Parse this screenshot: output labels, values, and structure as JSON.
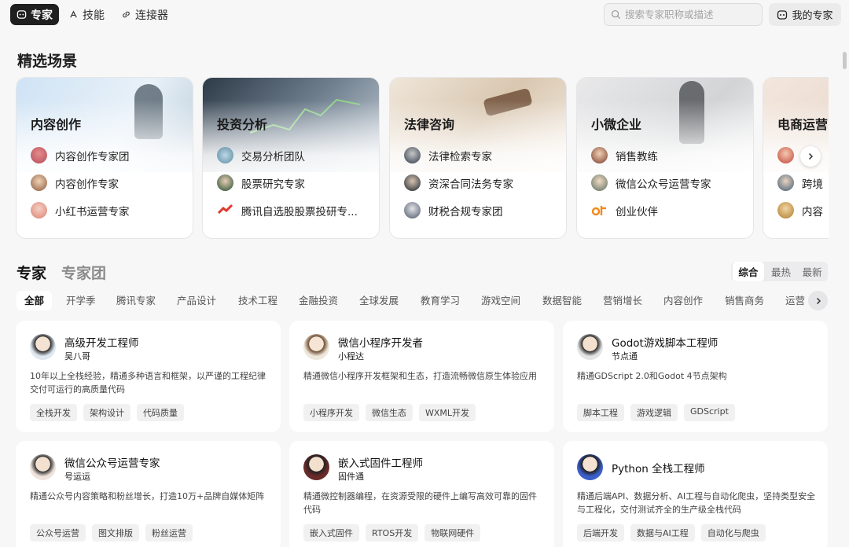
{
  "topnav": {
    "tabs": [
      {
        "label": "专家",
        "icon": "expert-icon"
      },
      {
        "label": "技能",
        "icon": "skill-icon"
      },
      {
        "label": "连接器",
        "icon": "link-icon"
      }
    ],
    "search_placeholder": "搜索专家职称或描述",
    "my_experts_label": "我的专家"
  },
  "featured": {
    "title": "精选场景",
    "cards": [
      {
        "title": "内容创作",
        "items": [
          "内容创作专家团",
          "内容创作专家",
          "小红书运营专家"
        ]
      },
      {
        "title": "投资分析",
        "items": [
          "交易分析团队",
          "股票研究专家",
          "腾讯自选股股票投研专..."
        ]
      },
      {
        "title": "法律咨询",
        "items": [
          "法律检索专家",
          "资深合同法务专家",
          "财税合规专家团"
        ]
      },
      {
        "title": "小微企业",
        "items": [
          "销售教练",
          "微信公众号运营专家",
          "创业伙伴"
        ]
      },
      {
        "title": "电商运营",
        "items": [
          "",
          "跨境",
          "内容"
        ]
      }
    ]
  },
  "experts_section": {
    "tab_experts": "专家",
    "tab_teams": "专家团",
    "sort_options": [
      "综合",
      "最热",
      "最新"
    ],
    "categories": [
      "全部",
      "开学季",
      "腾讯专家",
      "产品设计",
      "技术工程",
      "金融投资",
      "全球发展",
      "教育学习",
      "游戏空间",
      "数据智能",
      "营销增长",
      "内容创作",
      "销售商务",
      "运营"
    ]
  },
  "experts": [
    {
      "name": "高级开发工程师",
      "sub": "吴八哥",
      "desc": "10年以上全栈经验，精通多种语言和框架，以严谨的工程纪律交付可运行的高质量代码",
      "tags": [
        "全栈开发",
        "架构设计",
        "代码质量"
      ]
    },
    {
      "name": "微信小程序开发者",
      "sub": "小程达",
      "desc": "精通微信小程序开发框架和生态，打造流畅微信原生体验应用",
      "tags": [
        "小程序开发",
        "微信生态",
        "WXML开发"
      ]
    },
    {
      "name": "Godot游戏脚本工程师",
      "sub": "节点通",
      "desc": "精通GDScript 2.0和Godot 4节点架构",
      "tags": [
        "脚本工程",
        "游戏逻辑",
        "GDScript"
      ]
    },
    {
      "name": "微信公众号运营专家",
      "sub": "号运运",
      "desc": "精通公众号内容策略和粉丝增长，打造10万+品牌自媒体矩阵",
      "tags": [
        "公众号运营",
        "图文排版",
        "粉丝运营"
      ]
    },
    {
      "name": "嵌入式固件工程师",
      "sub": "固件通",
      "desc": "精通微控制器编程，在资源受限的硬件上编写高效可靠的固件代码",
      "tags": [
        "嵌入式固件",
        "RTOS开发",
        "物联网硬件"
      ]
    },
    {
      "name": "Python 全栈工程师",
      "sub": "",
      "desc": "精通后端API、数据分析、AI工程与自动化爬虫，坚持类型安全与工程化，交付测试齐全的生产级全栈代码",
      "tags": [
        "后端开发",
        "数据与AI工程",
        "自动化与爬虫"
      ]
    }
  ]
}
